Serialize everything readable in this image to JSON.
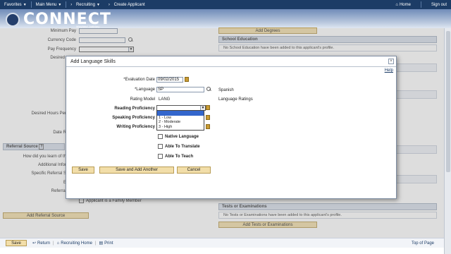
{
  "topbar": {
    "favorites": "Favorites",
    "main_menu": "Main Menu",
    "breadcrumb_recruiting": "Recruiting",
    "breadcrumb_create": "Create Applicant",
    "home": "Home",
    "sign_out": "Sign out"
  },
  "logo": {
    "name": "CONNECT",
    "subtitle": "Maryland Judiciary"
  },
  "form": {
    "minimum_pay": "Minimum Pay",
    "currency_code": "Currency Code",
    "pay_frequency": "Pay Frequency",
    "desired": "Desired",
    "desired_hours": "Desired Hours Per",
    "date_r": "Date R",
    "referral_source_header": "Referral Source",
    "how_did_you_learn": "How did you learn of th",
    "additional_info": "Additional Infor",
    "specific_referral": "Specific Referral S",
    "e_label": "E",
    "referral_label": "Referral",
    "family_member": "Applicant is a Family Member",
    "add_referral_source": "Add Referral Source"
  },
  "right_panel": {
    "add_degrees": "Add Degrees",
    "school_education_header": "School Education",
    "school_education_empty": "No School Education have been added to this applicant's profile.",
    "tests_header": "Tests or Examinations",
    "tests_empty": "No Tests or Examinations have been added to this applicant's profile.",
    "add_tests": "Add Tests or Examinations"
  },
  "footer": {
    "save": "Save",
    "return": "Return",
    "recruiting_home": "Recruiting Home",
    "print": "Print",
    "top_of_page": "Top of Page"
  },
  "modal": {
    "title": "Add Language Skills",
    "help": "Help",
    "evaluation_date_label": "*Evaluation Date",
    "evaluation_date_value": "09/02/2015",
    "language_label": "*Language",
    "language_value": "SP",
    "language_desc": "Spanish",
    "rating_model_label": "Rating Model",
    "rating_model_value": "LANG",
    "rating_model_desc": "Language Ratings",
    "reading_label": "Reading Proficiency",
    "speaking_label": "Speaking Proficiency",
    "writing_label": "Writing Proficiency",
    "dropdown_options": [
      "",
      "1 - Low",
      "2 - Moderate",
      "3 - High"
    ],
    "native_language": "Native Language",
    "able_to_translate": "Able To Translate",
    "able_to_teach": "Able To Teach",
    "save": "Save",
    "save_and_add_another": "Save and Add Another",
    "cancel": "Cancel"
  }
}
